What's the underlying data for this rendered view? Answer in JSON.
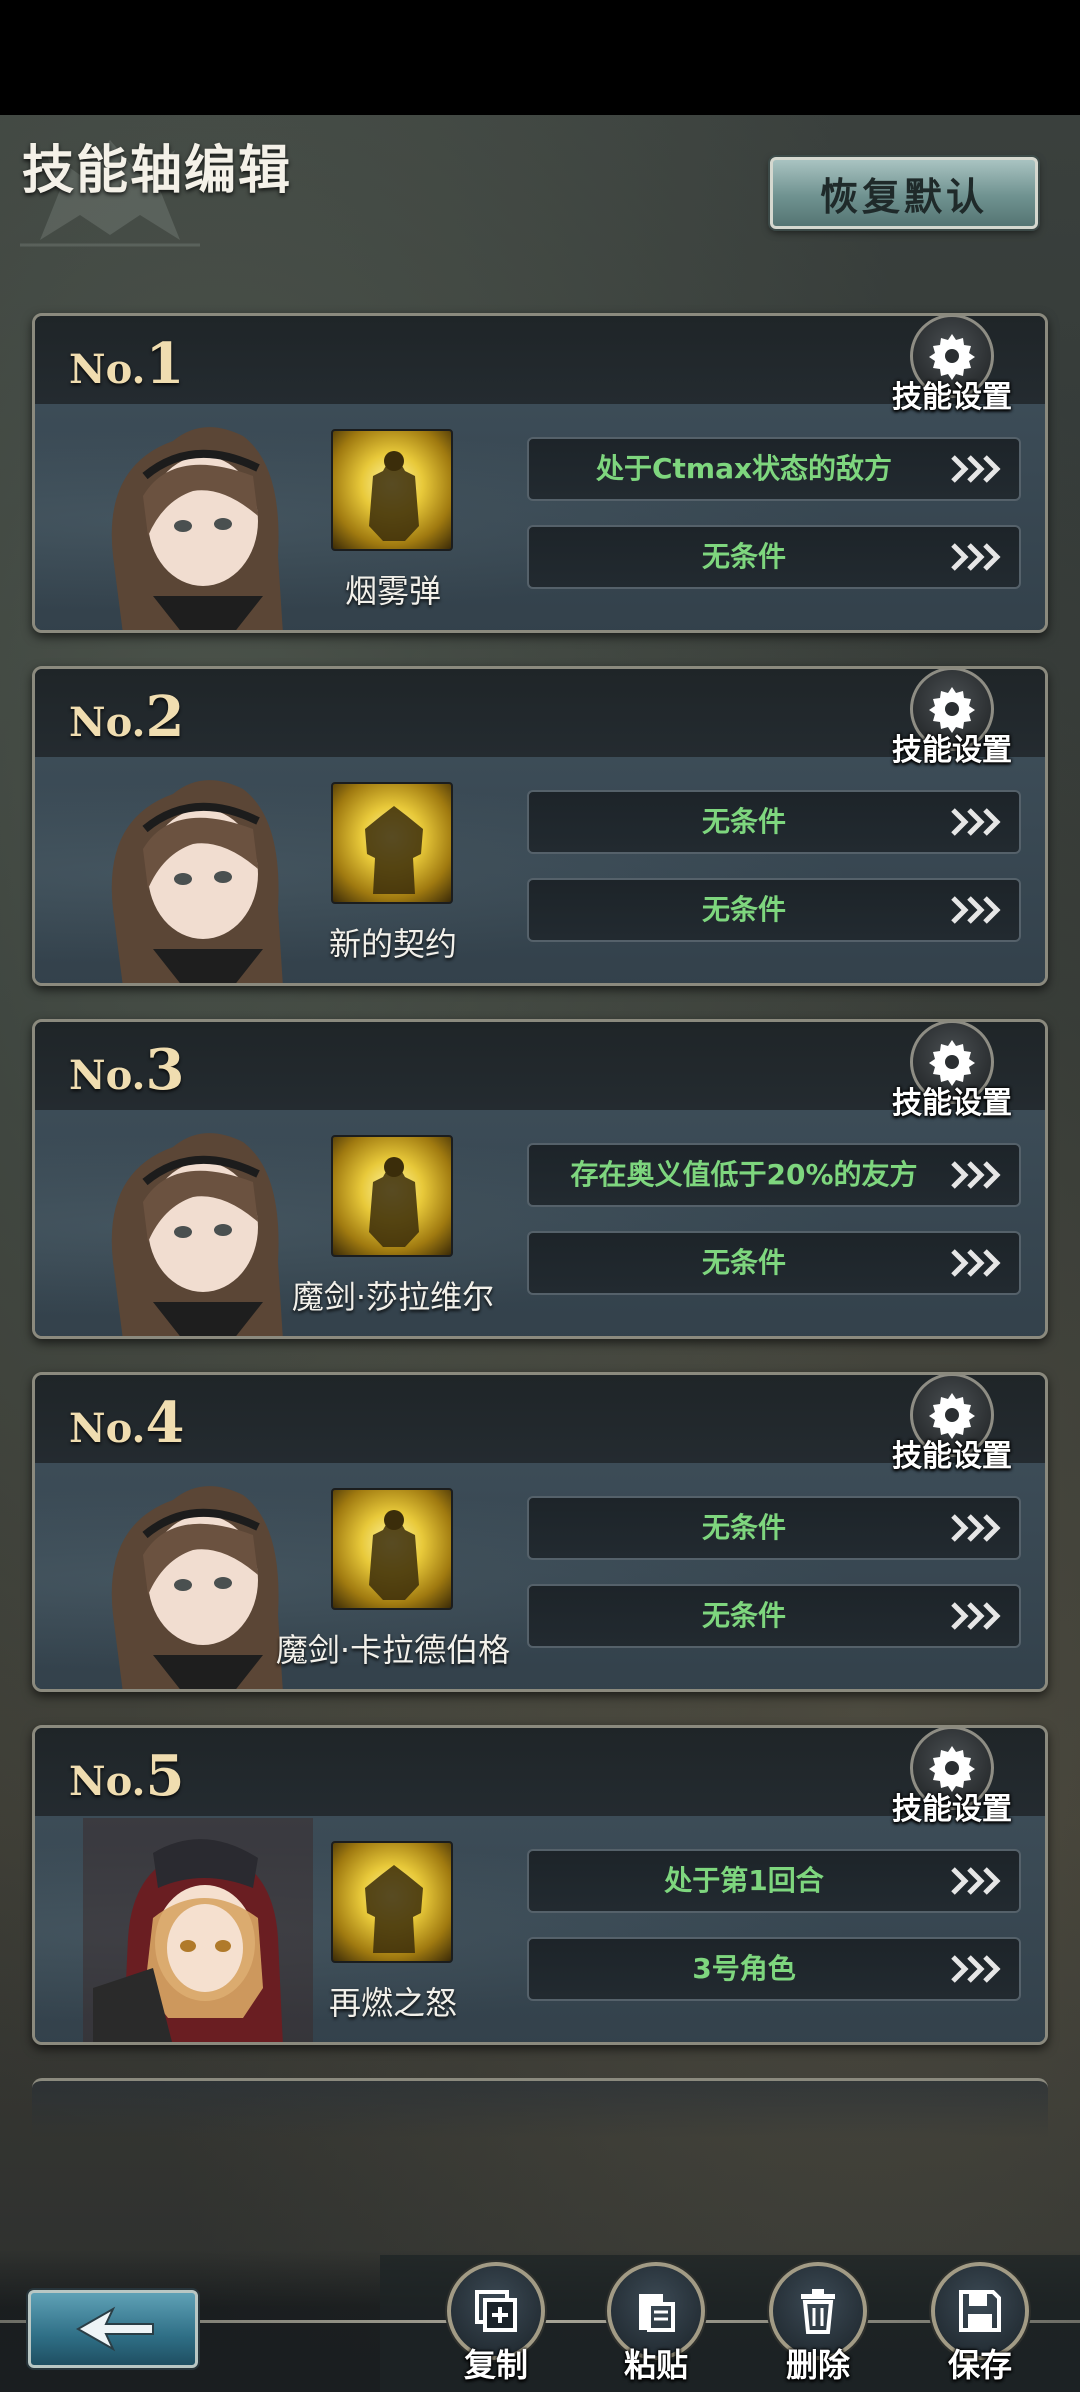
{
  "header": {
    "title": "技能轴编辑",
    "reset_label": "恢复默认"
  },
  "settings_label": "技能设置",
  "colors": {
    "condition_text": "#7ed67e",
    "number_text": "#f0ddb0",
    "reset_button": "#6f9290"
  },
  "cards": [
    {
      "no_prefix": "No.",
      "no": "1",
      "skill_name": "烟雾弹",
      "conditions": [
        "处于Ctmax状态的敌方",
        "无条件"
      ],
      "portrait": "brown-hair-character",
      "skill_icon": "glowing-figure-icon"
    },
    {
      "no_prefix": "No.",
      "no": "2",
      "skill_name": "新的契约",
      "conditions": [
        "无条件",
        "无条件"
      ],
      "portrait": "brown-hair-character",
      "skill_icon": "glowing-armored-figure-icon"
    },
    {
      "no_prefix": "No.",
      "no": "3",
      "skill_name": "魔剑·莎拉维尔",
      "conditions": [
        "存在奥义值低于20%的友方",
        "无条件"
      ],
      "portrait": "brown-hair-character",
      "skill_icon": "glowing-figure-icon"
    },
    {
      "no_prefix": "No.",
      "no": "4",
      "skill_name": "魔剑·卡拉德伯格",
      "conditions": [
        "无条件",
        "无条件"
      ],
      "portrait": "brown-hair-character",
      "skill_icon": "glowing-figure-icon"
    },
    {
      "no_prefix": "No.",
      "no": "5",
      "skill_name": "再燃之怒",
      "conditions": [
        "处于第1回合",
        "3号角色"
      ],
      "portrait": "blonde-hooded-character",
      "skill_icon": "glowing-armored-figure-icon"
    }
  ],
  "bottom": {
    "copy_label": "复制",
    "paste_label": "粘贴",
    "delete_label": "删除",
    "save_label": "保存"
  }
}
